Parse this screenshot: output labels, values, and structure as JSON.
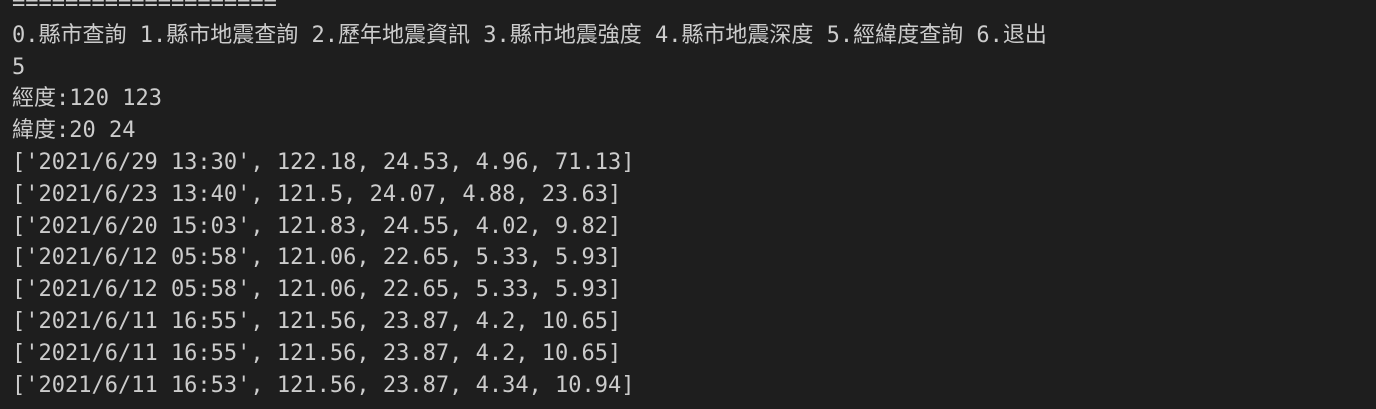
{
  "terminal": {
    "lines": [
      "====================",
      "0.縣市查詢 1.縣市地震查詢 2.歷年地震資訊 3.縣市地震強度 4.縣市地震深度 5.經緯度查詢 6.退出",
      "5",
      "經度:120 123",
      "緯度:20 24",
      "['2021/6/29 13:30', 122.18, 24.53, 4.96, 71.13]",
      "['2021/6/23 13:40', 121.5, 24.07, 4.88, 23.63]",
      "['2021/6/20 15:03', 121.83, 24.55, 4.02, 9.82]",
      "['2021/6/12 05:58', 121.06, 22.65, 5.33, 5.93]",
      "['2021/6/12 05:58', 121.06, 22.65, 5.33, 5.93]",
      "['2021/6/11 16:55', 121.56, 23.87, 4.2, 10.65]",
      "['2021/6/11 16:55', 121.56, 23.87, 4.2, 10.65]",
      "['2021/6/11 16:53', 121.56, 23.87, 4.34, 10.94]"
    ]
  }
}
